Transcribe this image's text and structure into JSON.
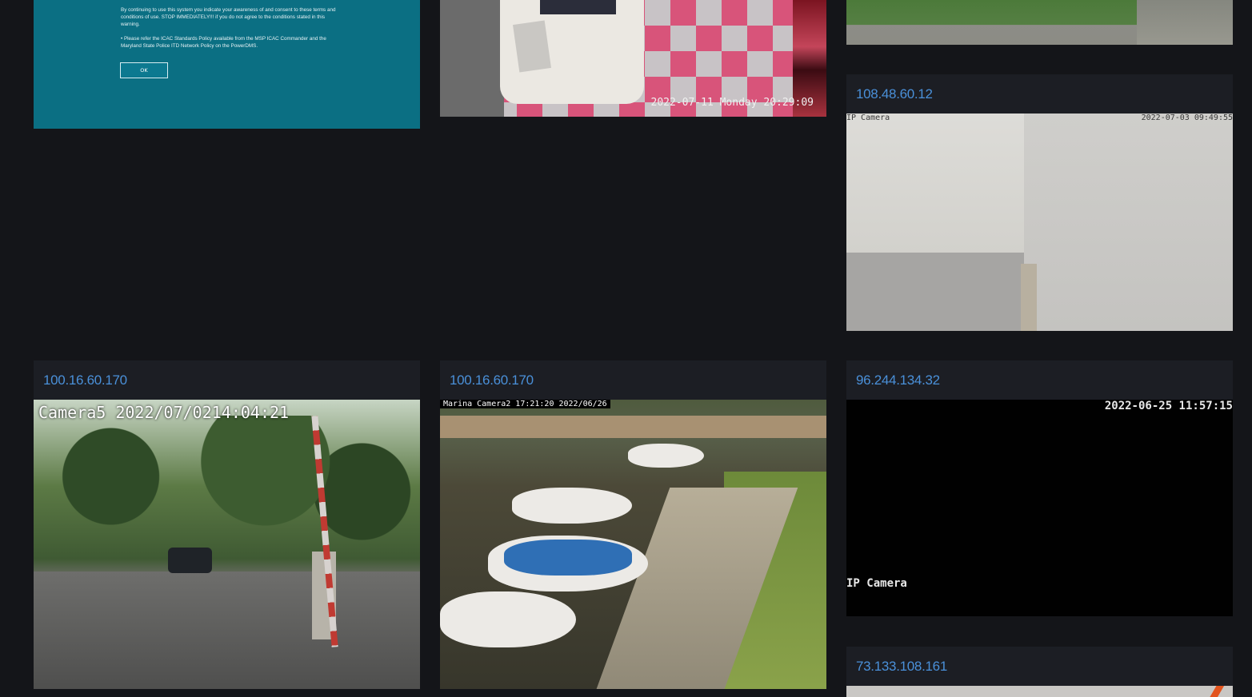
{
  "cards": [
    {
      "title": "108.48.60.12"
    },
    {
      "title": "100.16.60.170"
    },
    {
      "title": "100.16.60.170"
    },
    {
      "title": "96.244.134.32"
    },
    {
      "title": "73.133.108.161"
    }
  ],
  "feeds": {
    "banner": {
      "para1": "By continuing to use this system you indicate your awareness of and consent to these terms and conditions of use. STOP IMMEDIATELY!!! if you do not agree to the conditions stated in this warning.",
      "para2": "• Please refer the ICAC Standards Policy available from the MSP ICAC Commander and the Maryland State Police ITD Network Policy on the PowerDMS.",
      "ok_label": "OK"
    },
    "room": {
      "timestamp": "2022-07-11 Monday 20:29:09"
    },
    "wall": {
      "label": "IP Camera",
      "timestamp": "2022-07-03 09:49:55"
    },
    "gate": {
      "overlay": "Camera5  2022/07/0214:04:21"
    },
    "marina": {
      "overlay": "Marina Camera2 17:21:20 2022/06/26"
    },
    "dark": {
      "timestamp": "2022-06-25 11:57:15",
      "label": "IP Camera"
    }
  }
}
